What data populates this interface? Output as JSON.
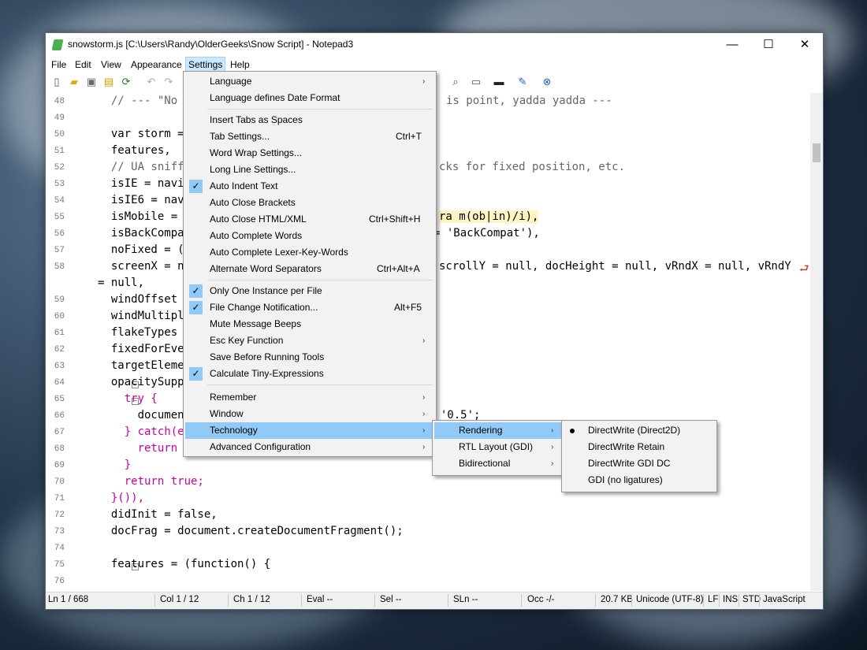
{
  "window": {
    "title": "snowstorm.js [C:\\Users\\Randy\\OlderGeeks\\Snow Script] - Notepad3",
    "minimize": "—",
    "maximize": "☐",
    "close": "✕"
  },
  "menubar": [
    "File",
    "Edit",
    "View",
    "Appearance",
    "Settings",
    "Help"
  ],
  "editor": {
    "lines": [
      {
        "n": "48",
        "text": "  // --- \"No"
      },
      {
        "n": "49",
        "text": ""
      },
      {
        "n": "50",
        "text": "  var storm ="
      },
      {
        "n": "51",
        "text": "  features,"
      },
      {
        "n": "52",
        "text": "  // UA sniff"
      },
      {
        "n": "53",
        "text": "  isIE = navi"
      },
      {
        "n": "54",
        "text": "  isIE6 = nav"
      },
      {
        "n": "55",
        "text": "  isMobile ="
      },
      {
        "n": "56",
        "text": "  isBackCompa"
      },
      {
        "n": "57",
        "text": "  noFixed = ("
      },
      {
        "n": "58",
        "text": "  screenX = n"
      },
      {
        "n": "",
        "text": "= null,"
      },
      {
        "n": "59",
        "text": "  windOffset"
      },
      {
        "n": "60",
        "text": "  windMultipl"
      },
      {
        "n": "61",
        "text": "  flakeTypes"
      },
      {
        "n": "62",
        "text": "  fixedForEve"
      },
      {
        "n": "63",
        "text": "  targetEleme"
      },
      {
        "n": "64",
        "text": "  opacitySupp"
      },
      {
        "n": "65",
        "text": "    try {"
      },
      {
        "n": "66",
        "text": "      documen"
      },
      {
        "n": "67",
        "text": "    } catch(e"
      },
      {
        "n": "68",
        "text": "      return"
      },
      {
        "n": "69",
        "text": "    }"
      },
      {
        "n": "70",
        "text": "    return true;"
      },
      {
        "n": "71",
        "text": "  }()),"
      },
      {
        "n": "72",
        "text": "  didInit = false,"
      },
      {
        "n": "73",
        "text": "  docFrag = document.createDocumentFragment();"
      },
      {
        "n": "74",
        "text": ""
      },
      {
        "n": "75",
        "text": "  features = (function() {"
      },
      {
        "n": "76",
        "text": ""
      }
    ],
    "right_fragments": [
      "is point, yadda yadda ---",
      "cks for fixed position, etc.",
      "ra m(ob|in)/i),",
      "= 'BackCompat'),",
      "scrollY = null, docHeight = null, vRndX = null, vRndY",
      "= '0.5';"
    ],
    "wrap_glyph": "⮐"
  },
  "statusbar": [
    "Ln  1 / 668",
    "Col  1 / 12",
    "Ch  1 / 12",
    "Eval  --",
    "Sel  --",
    "SLn  --",
    "Occ  -/-",
    "20.7 KB",
    "Unicode (UTF-8)",
    "LF",
    "INS",
    "STD",
    "JavaScript"
  ],
  "settings_menu": [
    {
      "label": "Language",
      "submenu": true
    },
    {
      "label": "Language defines Date Format"
    },
    {
      "label": "Insert Tabs as Spaces"
    },
    {
      "label": "Tab Settings...",
      "shortcut": "Ctrl+T"
    },
    {
      "label": "Word Wrap Settings..."
    },
    {
      "label": "Long Line Settings..."
    },
    {
      "label": "Auto Indent Text",
      "checked": true
    },
    {
      "label": "Auto Close Brackets"
    },
    {
      "label": "Auto Close HTML/XML",
      "shortcut": "Ctrl+Shift+H"
    },
    {
      "label": "Auto Complete Words"
    },
    {
      "label": "Auto Complete Lexer-Key-Words"
    },
    {
      "label": "Alternate Word Separators",
      "shortcut": "Ctrl+Alt+A"
    },
    {
      "label": "Only One Instance per File",
      "checked": true
    },
    {
      "label": "File Change Notification...",
      "shortcut": "Alt+F5",
      "checked": true
    },
    {
      "label": "Mute Message Beeps"
    },
    {
      "label": "Esc Key Function",
      "submenu": true
    },
    {
      "label": "Save Before Running Tools"
    },
    {
      "label": "Calculate Tiny-Expressions",
      "checked": true
    },
    {
      "label": "Remember",
      "submenu": true
    },
    {
      "label": "Window",
      "submenu": true
    },
    {
      "label": "Technology",
      "submenu": true,
      "highlighted": true
    },
    {
      "label": "Advanced Configuration",
      "submenu": true
    }
  ],
  "technology_menu": [
    {
      "label": "Rendering",
      "submenu": true,
      "highlighted": true
    },
    {
      "label": "RTL Layout (GDI)",
      "submenu": true
    },
    {
      "label": "Bidirectional",
      "submenu": true
    }
  ],
  "rendering_menu": [
    {
      "label": "DirectWrite (Direct2D)",
      "selected": true
    },
    {
      "label": "DirectWrite Retain"
    },
    {
      "label": "DirectWrite GDI DC"
    },
    {
      "label": "GDI (no ligatures)"
    }
  ],
  "submenu_arrow": "›",
  "check_glyph": "✓",
  "toolbar_icons": [
    "new-file-icon",
    "open-folder-icon",
    "save-icon",
    "save-as-icon",
    "revert-icon",
    "undo-icon",
    "redo-icon",
    "find-icon",
    "zoom-icon",
    "view-icon",
    "terminal-icon",
    "pin-icon",
    "close-circle-icon"
  ]
}
